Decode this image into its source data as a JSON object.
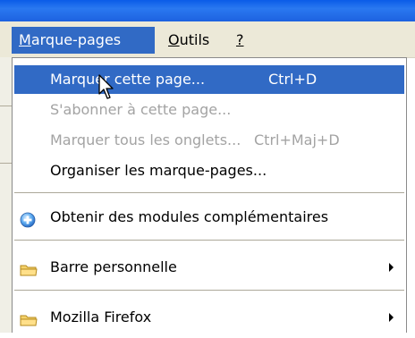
{
  "menubar": {
    "items": [
      {
        "label_accel": "M",
        "label_rest": "arque-pages"
      },
      {
        "label_accel": "O",
        "label_rest": "utils"
      },
      {
        "label_accel": "?",
        "label_rest": ""
      }
    ]
  },
  "menu": {
    "items": [
      {
        "label": "Marquer cette page...",
        "shortcut": "Ctrl+D"
      },
      {
        "label": "S'abonner à cette page..."
      },
      {
        "label": "Marquer tous les onglets...",
        "shortcut": "Ctrl+Maj+D"
      },
      {
        "label": "Organiser les marque-pages..."
      },
      {
        "label": "Obtenir des modules complémentaires",
        "icon": "add-ons-globe-icon"
      },
      {
        "label": "Barre personnelle",
        "icon": "folder-icon"
      },
      {
        "label": "Mozilla Firefox",
        "icon": "folder-icon"
      }
    ]
  },
  "colors": {
    "highlight": "#316ac5",
    "disabled_text": "#a3a3a3",
    "menubar_bg": "#ece9d8",
    "titlebar": "#1d62e0"
  }
}
